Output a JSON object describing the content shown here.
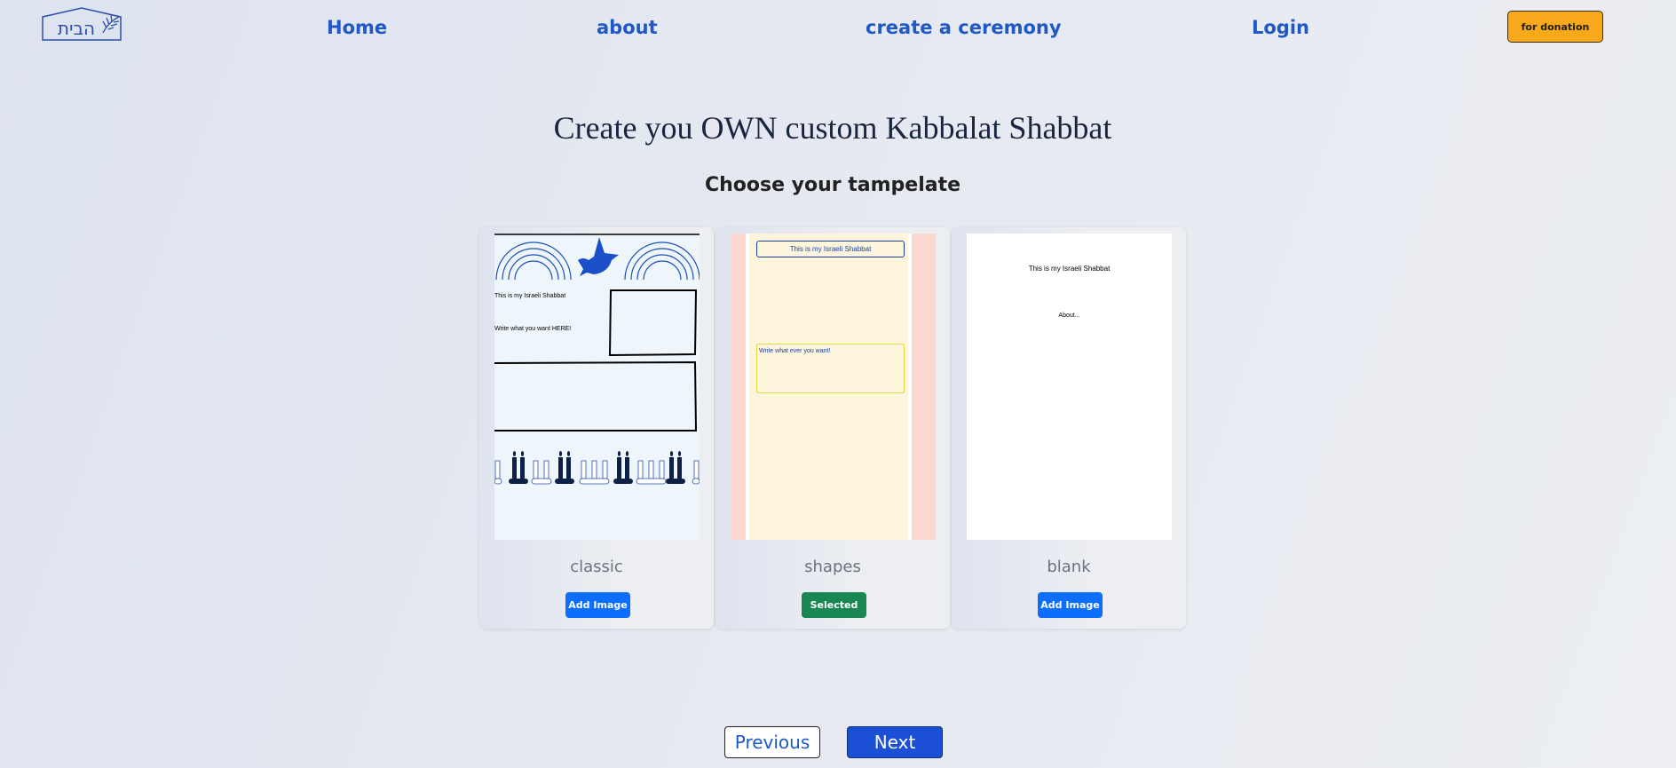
{
  "header": {
    "logo_text": "הבית",
    "logo_icon": "palm-frond-icon",
    "nav": [
      {
        "label": "Home"
      },
      {
        "label": "about"
      },
      {
        "label": "create a ceremony"
      },
      {
        "label": "Login"
      }
    ],
    "donate_label": "for donation"
  },
  "main": {
    "title": "Create you OWN custom Kabbalat Shabbat",
    "subtitle": "Choose your tampelate"
  },
  "templates": [
    {
      "name": "classic",
      "button": "Add Image",
      "selected": false,
      "preview_texts": [
        "This is my Israeli Shabbat",
        "Write what you want HERE!"
      ]
    },
    {
      "name": "shapes",
      "button": "Selected",
      "selected": true,
      "preview_texts": [
        "This is my Israeli Shabbat",
        "Write what ever you want!"
      ]
    },
    {
      "name": "blank",
      "button": "Add Image",
      "selected": false,
      "preview_texts": [
        "This is my Israeli Shabbat",
        "About..."
      ]
    }
  ],
  "pagination": {
    "previous_label": "Previous",
    "next_label": "Next"
  },
  "colors": {
    "nav_link": "#1f58c7",
    "donate_bg": "#f7a81b",
    "button_blue": "#0d6efd",
    "button_green": "#198754",
    "next_bg": "#1a4fd6"
  }
}
